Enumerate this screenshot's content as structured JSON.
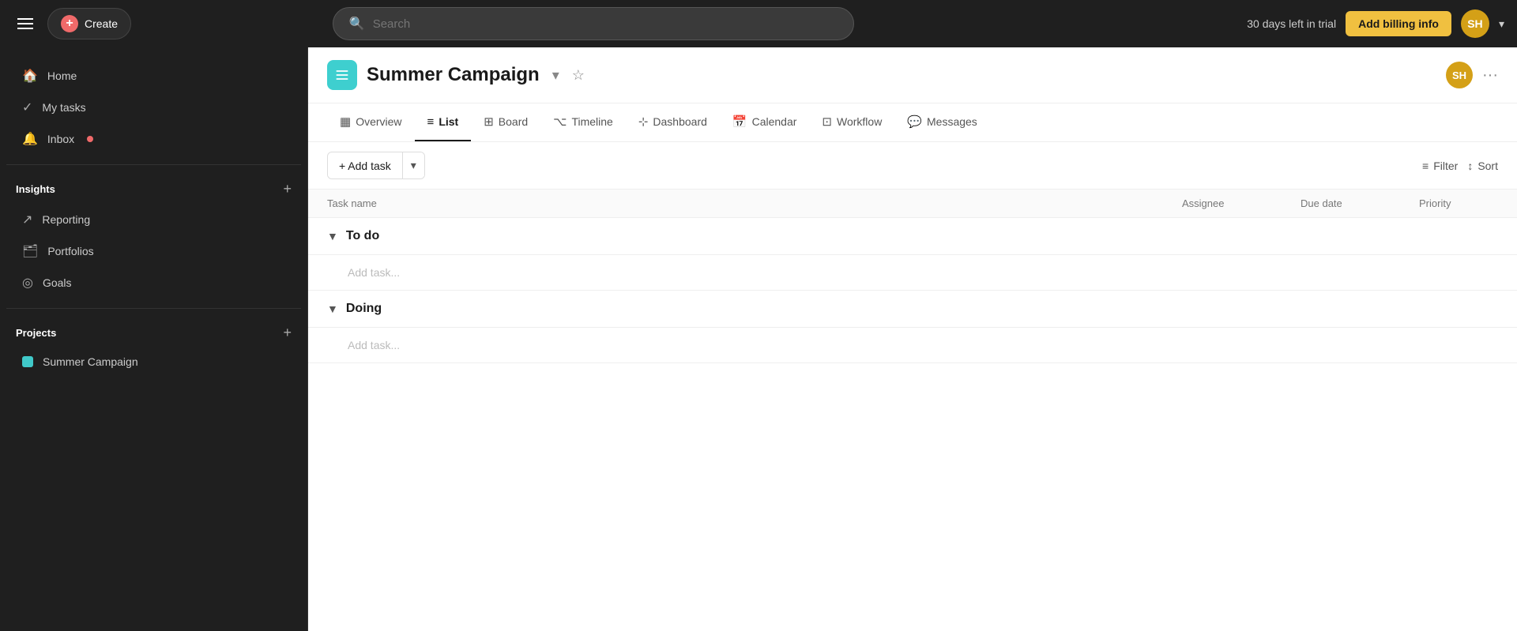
{
  "topbar": {
    "create_label": "Create",
    "search_placeholder": "Search",
    "trial_text": "30 days left in trial",
    "billing_btn": "Add billing info",
    "avatar_initials": "SH"
  },
  "sidebar": {
    "nav_items": [
      {
        "id": "home",
        "label": "Home",
        "icon": "🏠"
      },
      {
        "id": "my-tasks",
        "label": "My tasks",
        "icon": "✓"
      },
      {
        "id": "inbox",
        "label": "Inbox",
        "icon": "🔔",
        "dot": true
      }
    ],
    "insights_section": "Insights",
    "insights_items": [
      {
        "id": "reporting",
        "label": "Reporting",
        "icon": "↗"
      },
      {
        "id": "portfolios",
        "label": "Portfolios",
        "icon": "🗂"
      },
      {
        "id": "goals",
        "label": "Goals",
        "icon": "◎"
      }
    ],
    "projects_section": "Projects",
    "projects_items": [
      {
        "id": "summer-campaign",
        "label": "Summer Campaign"
      }
    ]
  },
  "project": {
    "title": "Summer Campaign",
    "avatar_initials": "SH"
  },
  "tabs": [
    {
      "id": "overview",
      "label": "Overview",
      "icon": "▦",
      "active": false
    },
    {
      "id": "list",
      "label": "List",
      "icon": "≡",
      "active": true
    },
    {
      "id": "board",
      "label": "Board",
      "icon": "⊞",
      "active": false
    },
    {
      "id": "timeline",
      "label": "Timeline",
      "icon": "⌥",
      "active": false
    },
    {
      "id": "dashboard",
      "label": "Dashboard",
      "icon": "⊹",
      "active": false
    },
    {
      "id": "calendar",
      "label": "Calendar",
      "icon": "📅",
      "active": false
    },
    {
      "id": "workflow",
      "label": "Workflow",
      "icon": "⊡",
      "active": false
    },
    {
      "id": "messages",
      "label": "Messages",
      "icon": "💬",
      "active": false
    }
  ],
  "toolbar": {
    "add_task_label": "+ Add task",
    "filter_label": "Filter",
    "sort_label": "Sort"
  },
  "table": {
    "col_task": "Task name",
    "col_assignee": "Assignee",
    "col_due": "Due date",
    "col_priority": "Priority"
  },
  "sections": [
    {
      "id": "todo",
      "title": "To do",
      "add_task_placeholder": "Add task..."
    },
    {
      "id": "doing",
      "title": "Doing",
      "add_task_placeholder": "Add task..."
    }
  ]
}
